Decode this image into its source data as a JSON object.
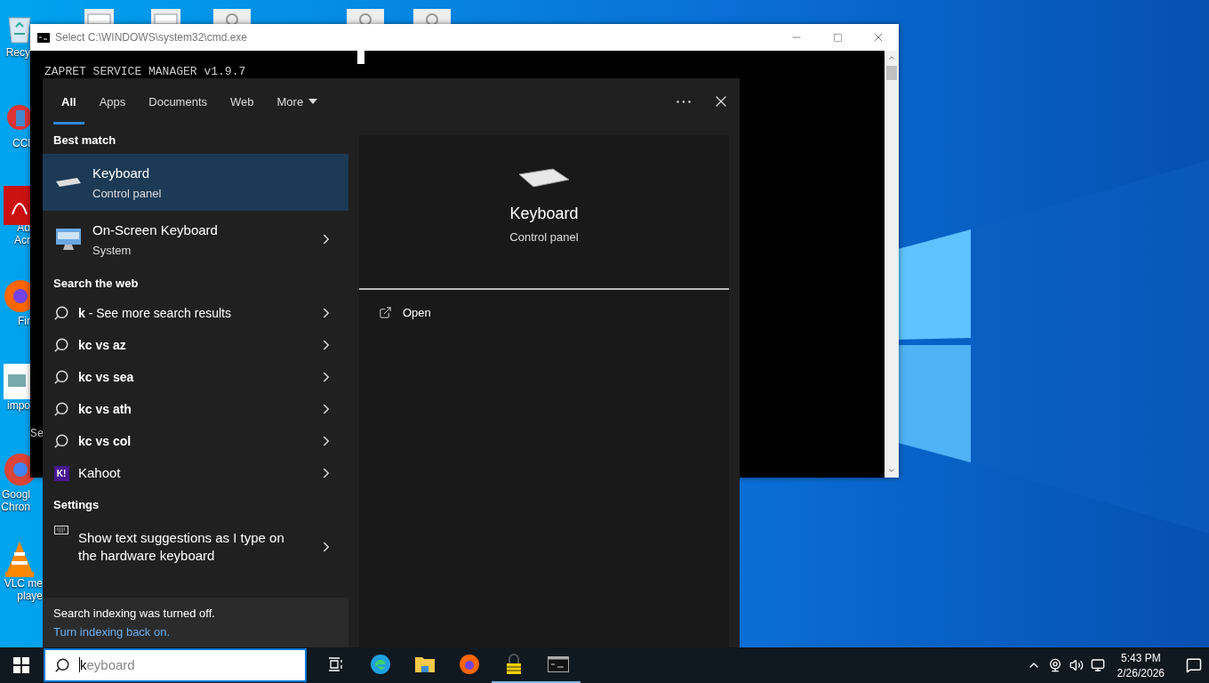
{
  "desktop": {
    "icons": [
      {
        "kind": "recycle",
        "lines": [
          "Recy"
        ]
      },
      {
        "kind": "ccleaner",
        "lines": [
          "CCl"
        ]
      },
      {
        "kind": "acrobat",
        "lines": [
          "Ad",
          "Acr"
        ]
      },
      {
        "kind": "firefox",
        "lines": [
          "Fir"
        ]
      },
      {
        "lines": [
          "impo"
        ]
      },
      {
        "kind": "chrome",
        "lines": [
          "Googl",
          "Chron"
        ]
      },
      {
        "kind": "vlc",
        "lines": [
          "VLC me",
          "playe"
        ]
      }
    ],
    "top_icons": [
      {
        "kind": "window"
      },
      {
        "kind": "window"
      },
      {
        "kind": "gear"
      },
      {
        "kind": "gear"
      },
      {
        "kind": "gear"
      }
    ]
  },
  "console_window": {
    "title": "Select C:\\WINDOWS\\system32\\cmd.exe",
    "lines": [
      "ZAPRET SERVICE MANAGER v1.9.7"
    ],
    "fragment": "Se"
  },
  "search_panel": {
    "tabs": [
      {
        "label": "All",
        "selected": true
      },
      {
        "label": "Apps",
        "selected": false
      },
      {
        "label": "Documents",
        "selected": false
      },
      {
        "label": "Web",
        "selected": false
      },
      {
        "label": "More",
        "selected": false,
        "menu": true
      }
    ],
    "sections": [
      {
        "heading": "Best match",
        "items": [
          {
            "kind": "app",
            "title": "Keyboard",
            "subtitle": "Control panel",
            "selected": true,
            "arrow": false
          },
          {
            "kind": "app",
            "title": "On-Screen Keyboard",
            "subtitle": "System",
            "selected": false,
            "arrow": true
          }
        ]
      },
      {
        "heading": "Search the web",
        "items": [
          {
            "kind": "web",
            "title": "**k** - See more search results",
            "selected": false,
            "arrow": true
          },
          {
            "kind": "web",
            "title": "kc vs az",
            "selected": false,
            "arrow": true
          },
          {
            "kind": "web",
            "title": "kc vs sea",
            "selected": false,
            "arrow": true
          },
          {
            "kind": "web",
            "title": "kc vs ath",
            "selected": false,
            "arrow": true
          },
          {
            "kind": "web",
            "title": "kc vs col",
            "selected": false,
            "arrow": true
          },
          {
            "kind": "site",
            "title": "Kahoot",
            "badge": "K!",
            "selected": false,
            "arrow": true
          }
        ]
      },
      {
        "heading": "Settings",
        "items": [
          {
            "kind": "setting",
            "title": "Show text suggestions as I type on the hardware keyboard",
            "selected": false,
            "arrow": true
          }
        ]
      }
    ],
    "notice": {
      "text": "Search indexing was turned off.",
      "link": "Turn indexing back on."
    },
    "preview": {
      "title": "Keyboard",
      "subtitle": "Control panel",
      "actions": [
        {
          "label": "Open"
        }
      ]
    }
  },
  "taskbar": {
    "search": {
      "value": "k",
      "completion": "eyboard"
    },
    "apps": [
      {
        "kind": "taskview",
        "running": false
      },
      {
        "kind": "edge",
        "running": false
      },
      {
        "kind": "explorer",
        "running": false
      },
      {
        "kind": "firefox",
        "running": false
      },
      {
        "kind": "lock",
        "running": true
      },
      {
        "kind": "console",
        "running": true
      }
    ],
    "clock": {
      "time": "5:43 PM",
      "date": "2/26/2026"
    }
  }
}
